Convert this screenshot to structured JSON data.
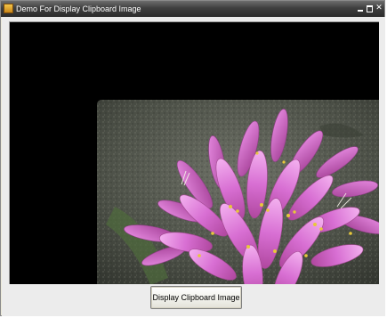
{
  "window": {
    "title": "Demo For Display Clipboard Image",
    "controls": {
      "minimize": "minimize",
      "maximize": "maximize",
      "close": "✕"
    }
  },
  "main": {
    "button_label": "Display Clipboard Image",
    "picture_box_background": "#000000",
    "image_subject": "pink-flower-photo"
  },
  "colors": {
    "title_bar": "#3f3f3f",
    "client_background": "#ececec",
    "petal": "#d46fd0",
    "ground": "#4a4f45"
  }
}
